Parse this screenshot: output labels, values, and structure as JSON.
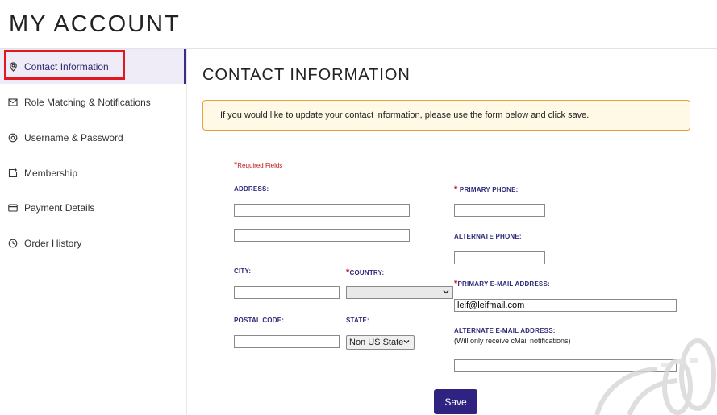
{
  "header": {
    "title": "MY ACCOUNT"
  },
  "sidebar": {
    "items": [
      {
        "label": "Contact Information",
        "icon": "location-pin-icon",
        "active": true
      },
      {
        "label": "Role Matching & Notifications",
        "icon": "envelope-icon",
        "active": false
      },
      {
        "label": "Username & Password",
        "icon": "at-sign-icon",
        "active": false
      },
      {
        "label": "Membership",
        "icon": "membership-icon",
        "active": false
      },
      {
        "label": "Payment Details",
        "icon": "credit-card-icon",
        "active": false
      },
      {
        "label": "Order History",
        "icon": "history-icon",
        "active": false
      }
    ]
  },
  "main": {
    "title": "CONTACT INFORMATION",
    "notice": "If you would like to update your contact information, please use the form below and click save."
  },
  "form": {
    "required_star": "*",
    "required_note": "Required Fields",
    "address_label": "ADDRESS:",
    "address1_value": "",
    "address2_value": "",
    "city_label": "CITY:",
    "city_value": "",
    "country_label": "COUNTRY:",
    "country_value": "",
    "postal_label": "POSTAL CODE:",
    "postal_value": "",
    "state_label": "STATE:",
    "state_value": "Non US State",
    "primary_phone_label": "PRIMARY PHONE:",
    "primary_phone_value": "",
    "alt_phone_label": "ALTERNATE PHONE:",
    "alt_phone_value": "",
    "primary_email_label": "PRIMARY E-MAIL ADDRESS:",
    "primary_email_value": "leif@leifmail.com",
    "alt_email_label": "ALTERNATE E-MAIL ADDRESS:",
    "alt_email_note": "(Will only receive cMail notifications)",
    "alt_email_value": "",
    "save_label": "Save"
  },
  "colors": {
    "accent": "#2e2380",
    "required": "#c0181d",
    "notice_border": "#e7a13b",
    "active_bg": "#efebf7",
    "highlight": "#e0191e"
  }
}
